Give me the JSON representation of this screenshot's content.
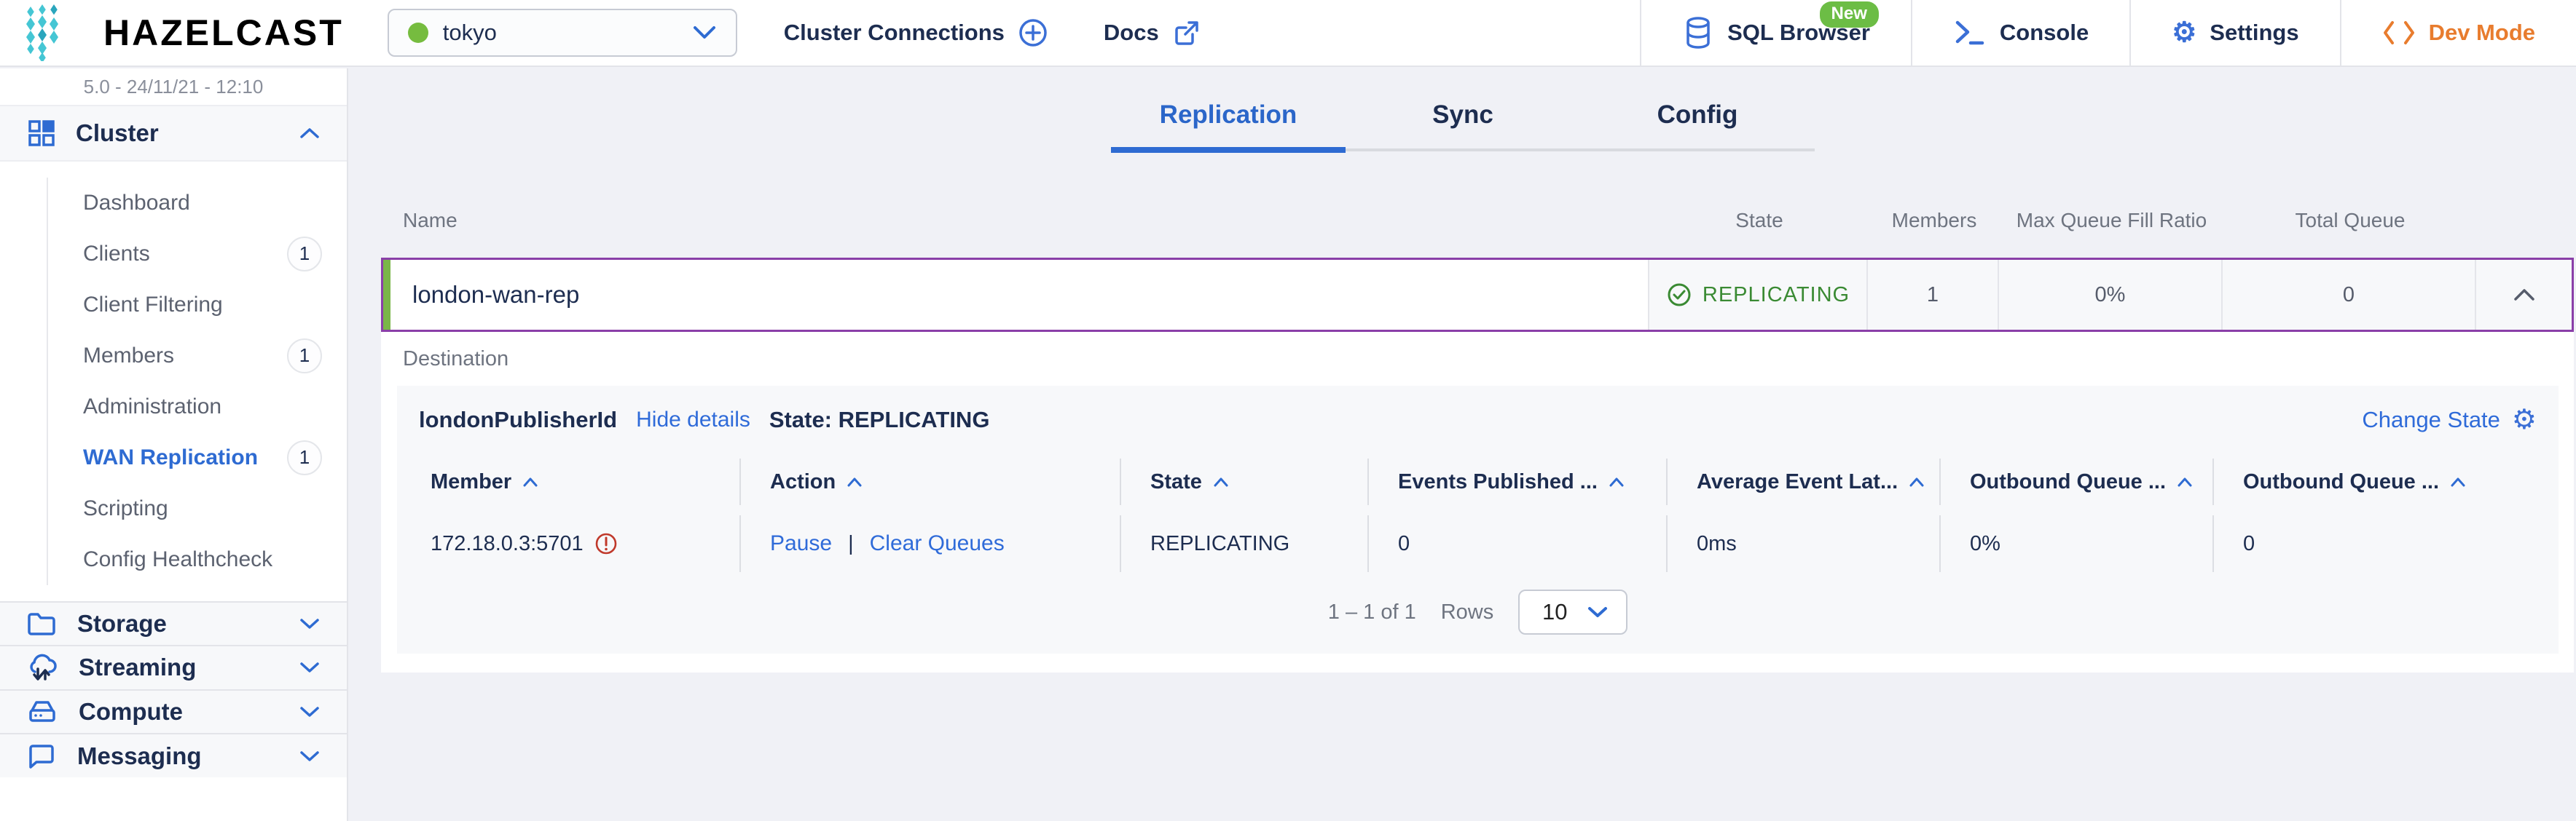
{
  "topbar": {
    "logo_text": "HAZELCAST",
    "cluster_select": {
      "value": "tokyo"
    },
    "cluster_connections_label": "Cluster Connections",
    "docs_label": "Docs",
    "sql_browser_label": "SQL Browser",
    "sql_browser_badge": "New",
    "console_label": "Console",
    "settings_label": "Settings",
    "dev_mode_label": "Dev Mode"
  },
  "sidebar": {
    "version": "5.0 - 24/11/21 - 12:10",
    "cluster_section": {
      "label": "Cluster",
      "icon": "grid-icon",
      "items": [
        {
          "label": "Dashboard"
        },
        {
          "label": "Clients",
          "badge": "1"
        },
        {
          "label": "Client Filtering"
        },
        {
          "label": "Members",
          "badge": "1"
        },
        {
          "label": "Administration"
        },
        {
          "label": "WAN Replication",
          "badge": "1"
        },
        {
          "label": "Scripting"
        },
        {
          "label": "Config Healthcheck"
        }
      ]
    },
    "sections": [
      {
        "label": "Storage",
        "icon": "folder-icon"
      },
      {
        "label": "Streaming",
        "icon": "cloud-icon"
      },
      {
        "label": "Compute",
        "icon": "server-icon"
      },
      {
        "label": "Messaging",
        "icon": "chat-icon"
      }
    ]
  },
  "main": {
    "tabs": [
      {
        "label": "Replication"
      },
      {
        "label": "Sync"
      },
      {
        "label": "Config"
      }
    ],
    "table": {
      "headers": [
        "Name",
        "State",
        "Members",
        "Max Queue Fill Ratio",
        "Total Queue"
      ],
      "row": {
        "name": "london-wan-rep",
        "state": "REPLICATING",
        "members": "1",
        "max_queue_fill_ratio": "0%",
        "total_queue": "0"
      }
    },
    "detail": {
      "destination_label": "Destination",
      "publisher_id": "londonPublisherId",
      "hide_details_label": "Hide details",
      "state_label": "State: REPLICATING",
      "change_state_label": "Change State",
      "member_table": {
        "headers": [
          "Member",
          "Action",
          "State",
          "Events Published ...",
          "Average Event Lat...",
          "Outbound Queue ...",
          "Outbound Queue ..."
        ],
        "row": {
          "member": "172.18.0.3:5701",
          "action_pause": "Pause",
          "action_separator": "|",
          "action_clear": "Clear Queues",
          "state": "REPLICATING",
          "events_published": "0",
          "avg_event_latency": "0ms",
          "outbound_queue_pct": "0%",
          "outbound_queue_count": "0"
        }
      },
      "pagination": {
        "range": "1 – 1 of 1",
        "rows_label": "Rows",
        "rows_value": "10"
      }
    }
  },
  "colors": {
    "accent_blue": "#2e6bd2",
    "status_green": "#3a8a33",
    "lime_green": "#76bc3f",
    "selection_purple": "#8a3fa8",
    "dev_mode_orange": "#e87c2e"
  }
}
